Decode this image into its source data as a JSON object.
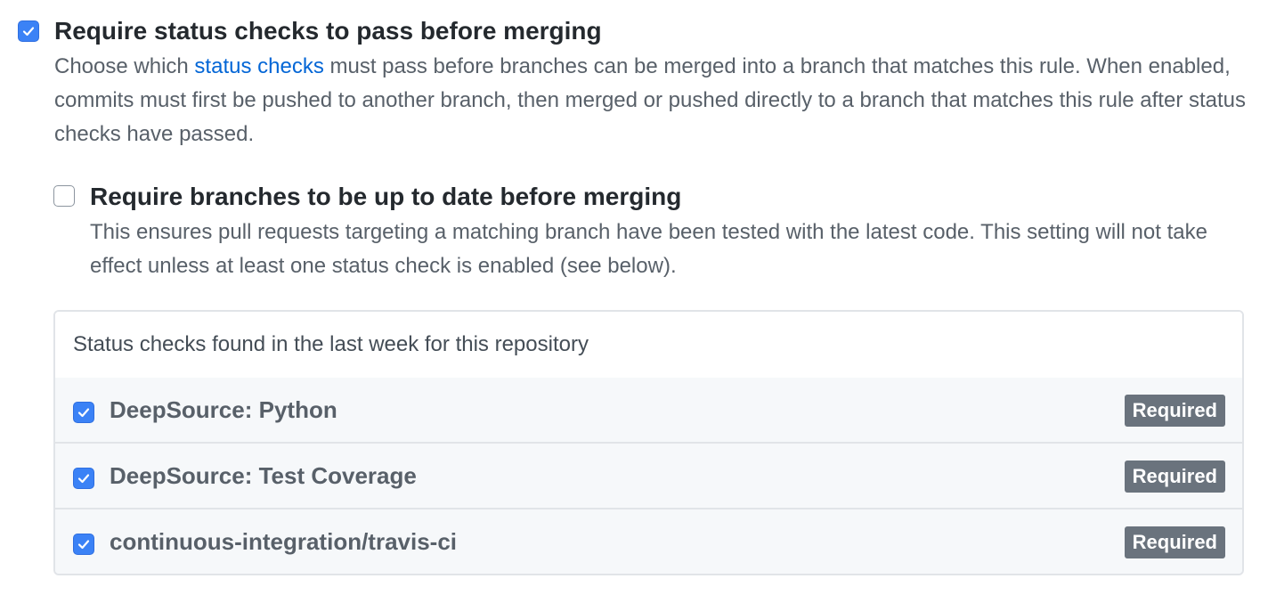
{
  "status_checks_rule": {
    "checked": true,
    "title": "Require status checks to pass before merging",
    "desc_before_link": "Choose which ",
    "desc_link": "status checks",
    "desc_after_link": " must pass before branches can be merged into a branch that matches this rule. When enabled, commits must first be pushed to another branch, then merged or pushed directly to a branch that matches this rule after status checks have passed."
  },
  "up_to_date_rule": {
    "checked": false,
    "title": "Require branches to be up to date before merging",
    "description": "This ensures pull requests targeting a matching branch have been tested with the latest code. This setting will not take effect unless at least one status check is enabled (see below)."
  },
  "status_checks_panel": {
    "header": "Status checks found in the last week for this repository",
    "checks": [
      {
        "name": "DeepSource: Python",
        "checked": true,
        "badge": "Required"
      },
      {
        "name": "DeepSource: Test Coverage",
        "checked": true,
        "badge": "Required"
      },
      {
        "name": "continuous-integration/travis-ci",
        "checked": true,
        "badge": "Required"
      }
    ]
  },
  "colors": {
    "accent": "#0366d6",
    "checkbox_checked": "#3b82f6",
    "badge_bg": "#6a737d"
  },
  "icons": {
    "checkbox_checked": "checkmark-icon"
  }
}
